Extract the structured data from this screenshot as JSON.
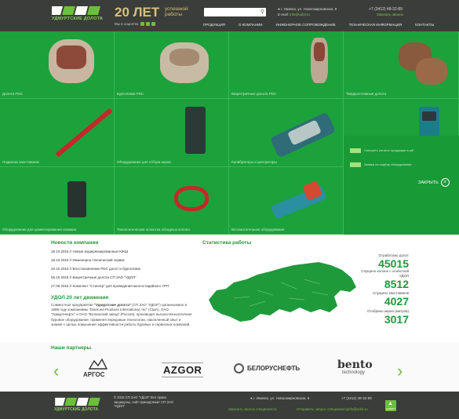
{
  "header": {
    "logo_text": "УДМУРТСКИЕ ДОЛОТА",
    "anniversary_number": "20 ЛЕТ",
    "anniversary_sub": "успешной работы",
    "social_label": "Мы в соцсетях",
    "search_placeholder": "",
    "address": "г. Ижевск, ул. Новосмирновская, 9",
    "email_label": "E-mail:",
    "email": "info@udol.ru",
    "phone": "+7 (3412) 48-32-89",
    "callback": "Заказать звонок",
    "nav": [
      "ПРОДУКЦИЯ",
      "О КОМПАНИИ",
      "ИНЖЕНЕРНОЕ СОПРОВОЖДЕНИЕ",
      "ТЕХНИЧЕСКАЯ ИНФОРМАЦИЯ",
      "КОНТАКТЫ"
    ]
  },
  "products": [
    "Долота PDC",
    "Бурголовки PDC",
    "Бицентричные долота PDC",
    "Твердосплавные долота",
    "Подвески хвостовиков",
    "Оборудование для отбора керна",
    "Калибраторы и центраторы",
    "Клапаны для ВЗД",
    "Оборудование для цементирования скважин",
    "Технологическая оснастка обсадных колонн",
    "Вспомогательное оборудование"
  ],
  "promo": {
    "item1": "Смотреть каталог продукции в pdf",
    "item2": "Заявка на подбор оборудования",
    "close": "ЗАКРЫТЬ"
  },
  "news": {
    "title": "Новости компании",
    "items": [
      {
        "date": "18.10.2016",
        "text": "Новые модернизированные КЖШ"
      },
      {
        "date": "18.10.2016",
        "text": "Инженерно-технический сервис"
      },
      {
        "date": "10.10.2016",
        "text": "Восстановление PDC долот и бурголовок"
      },
      {
        "date": "06.10.2016",
        "text": "Бицентричные долота СП ЗАО \"УДОЛ\""
      },
      {
        "date": "27.06.2016",
        "text": "Комплект \"Стингер\" для проведения многостадийного ГРП"
      }
    ]
  },
  "about": {
    "title": "УДОЛ 20 лет движения",
    "text_pre": "Совместное предприятие ",
    "text_bold": "\"Удмуртские долота\"",
    "text_post": " (СП ЗАО \"УДОЛ\") организовано в 1998 году компаниями \"Diamond Products International, Inc\" (США), ОАО \"Удмуртнефть\" и ОАО \"Воткинский завод\" (Россия), производит высокотехнологичное буровое оборудование, применяя передовые технологии, накопленный опыт и знания с целью повышения эффективности работы буровых и сервисных компаний."
  },
  "stats": {
    "title": "Статистика работы",
    "items": [
      {
        "label": "Отработано долот",
        "value": "45015"
      },
      {
        "label": "Спущено колонн с оснасткой\nУДОЛ",
        "value": "8512"
      },
      {
        "label": "Спущено хвостовиков",
        "value": "4027"
      },
      {
        "label": "Отобрано керна (метров)",
        "value": "3017"
      }
    ]
  },
  "partners": {
    "title": "Наши партнеры",
    "names": [
      "АРГОС",
      "AZGOR",
      "БЕЛОРУСНЕФТЬ",
      "bento",
      "technology"
    ]
  },
  "footer": {
    "logo_text": "УДМУРТСКИЕ ДОЛОТА",
    "copyright": "© 2016 СП ЗАО \"УДОЛ\" Все права защищены, сайт принадлежит СП ЗАО \"УДОЛ\"",
    "address": "г. Ижевск, ул. Новосмирновская, 9",
    "phone": "+7 (3412) 48-32-89",
    "link1": "Заказать звонок специалиста",
    "link2": "Отправить запрос специалисту",
    "link3": "info@udol.ru",
    "button": "НАВЕРХ"
  },
  "colors": {
    "header": "#3b3d3a",
    "green": "#1ba23b",
    "accent": "#6cbf3b",
    "gold": "#d7c178"
  }
}
